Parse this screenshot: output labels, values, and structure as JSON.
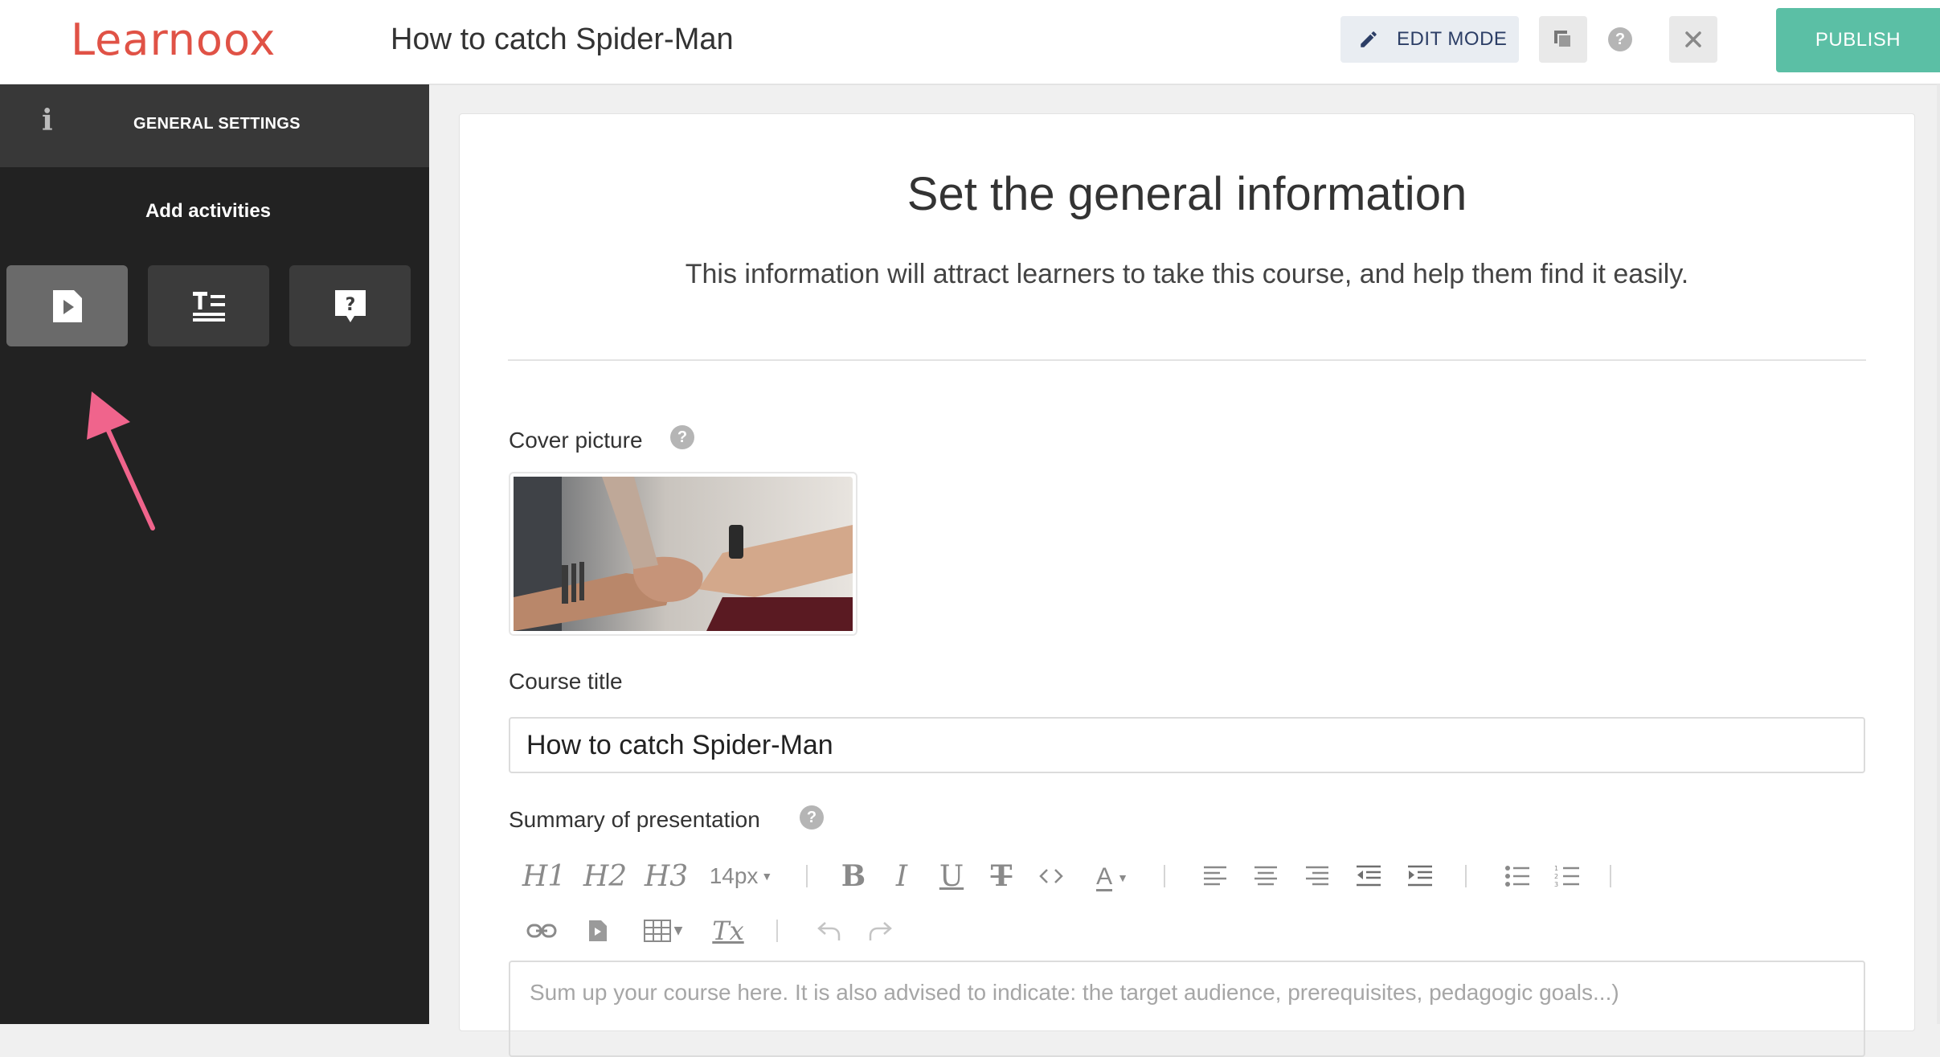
{
  "header": {
    "logo": "Learnoox",
    "course_name": "How to catch Spider-Man",
    "edit_mode_label": "EDIT MODE",
    "publish_label": "PUBLISH"
  },
  "sidebar": {
    "general_settings_label": "GENERAL SETTINGS",
    "add_activities_label": "Add activities",
    "activity_tiles": [
      "video-activity-icon",
      "text-activity-icon",
      "quiz-activity-icon"
    ]
  },
  "main": {
    "heading": "Set the general information",
    "subheading": "This information will attract learners to take this course, and help them find it easily.",
    "cover_label": "Cover picture",
    "title_label": "Course title",
    "title_value": "How to catch Spider-Man",
    "summary_label": "Summary of presentation",
    "summary_placeholder": "Sum up your course here. It is also advised to indicate: the target audience, prerequisites, pedagogic goals...)"
  },
  "toolbar": {
    "h1": "H1",
    "h2": "H2",
    "h3": "H3",
    "font_size": "14px",
    "bold": "B",
    "italic": "I",
    "underline": "U",
    "strike": "T",
    "color": "A",
    "clear_format": "Tx"
  },
  "colors": {
    "brand": "#e05246",
    "publish": "#5bbfa5",
    "sidebar": "#222222",
    "arrow": "#f0648c"
  }
}
